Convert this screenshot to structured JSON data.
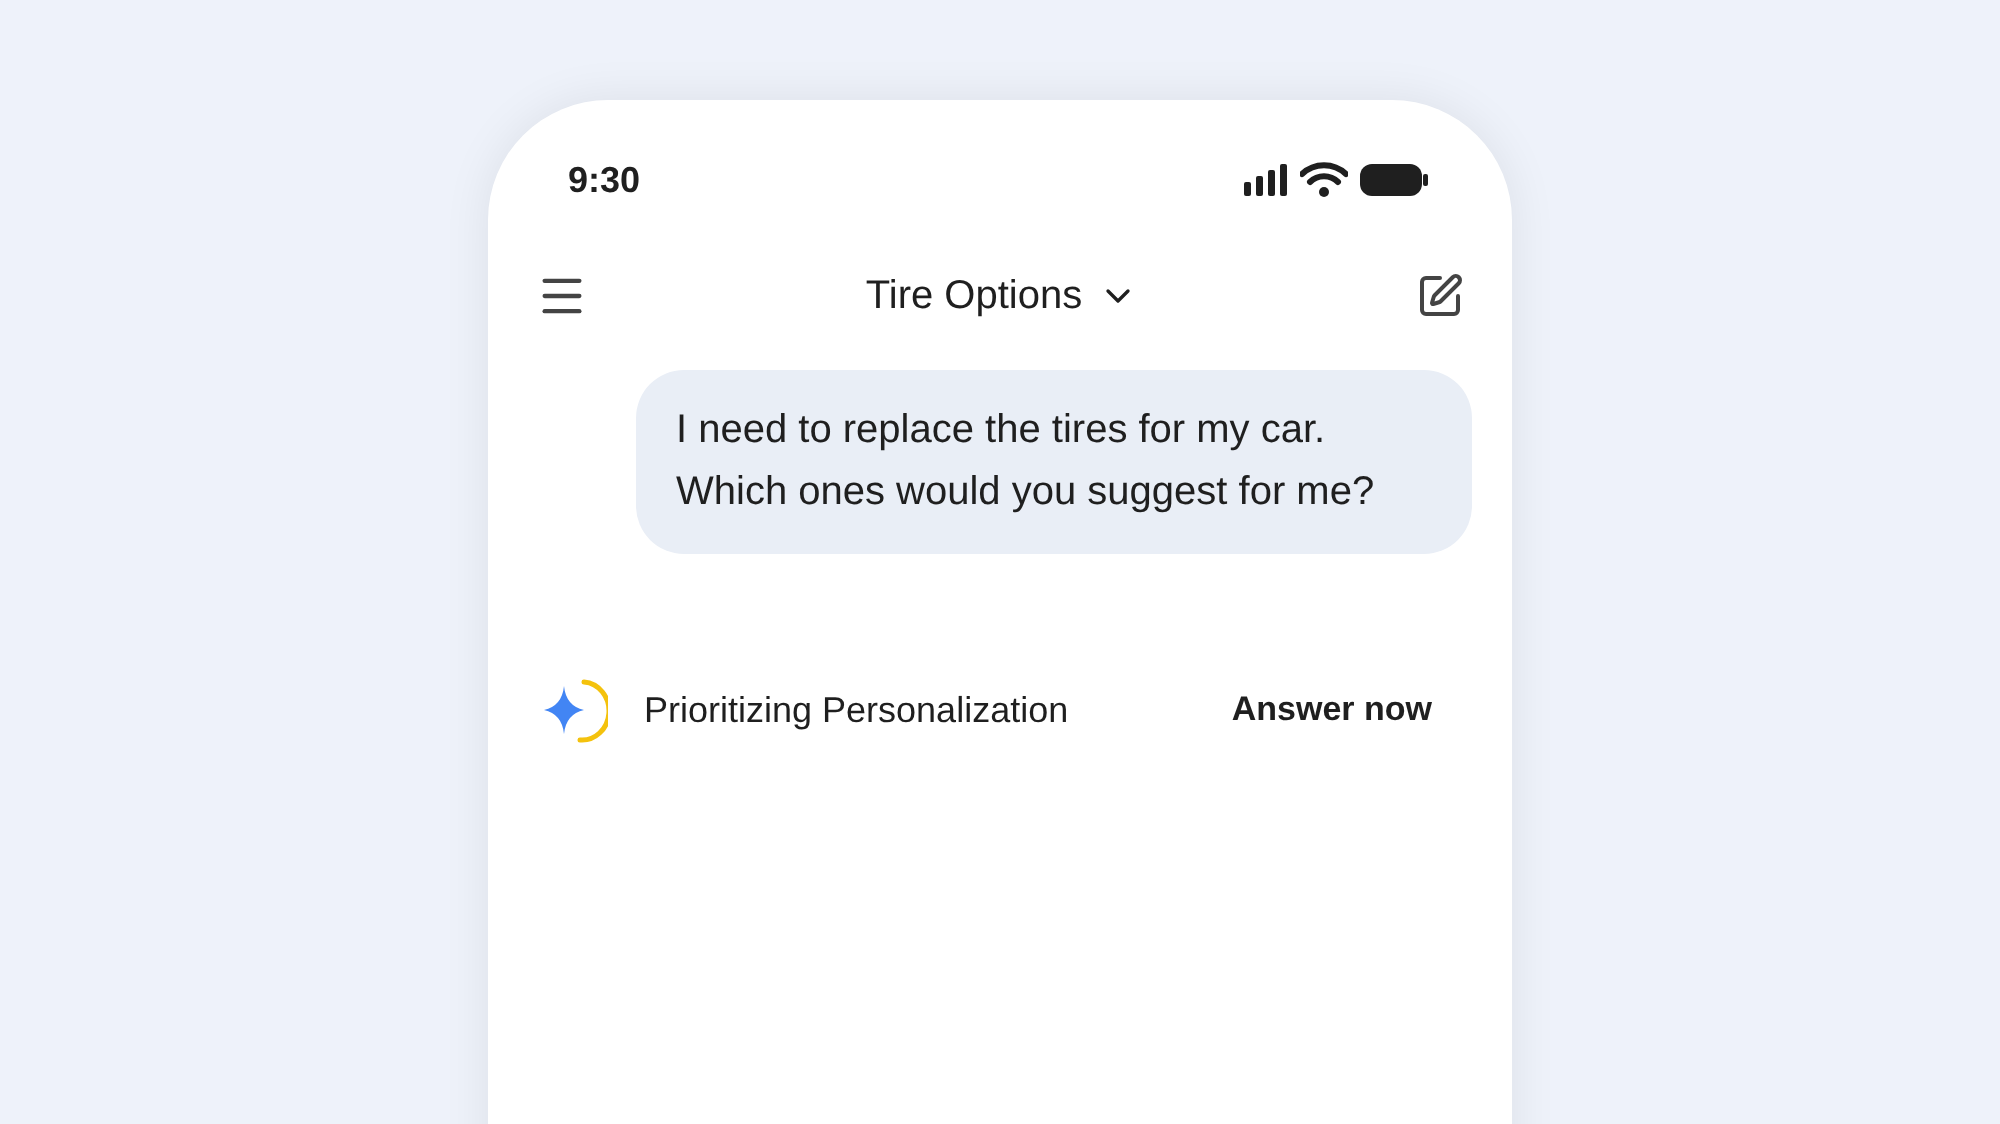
{
  "status_bar": {
    "time": "9:30"
  },
  "header": {
    "title": "Tire Options"
  },
  "message": {
    "text": "I need to replace the tires for my car. Which ones would you suggest for me?"
  },
  "thinking": {
    "label": "Prioritizing Personalization",
    "action": "Answer now"
  }
}
